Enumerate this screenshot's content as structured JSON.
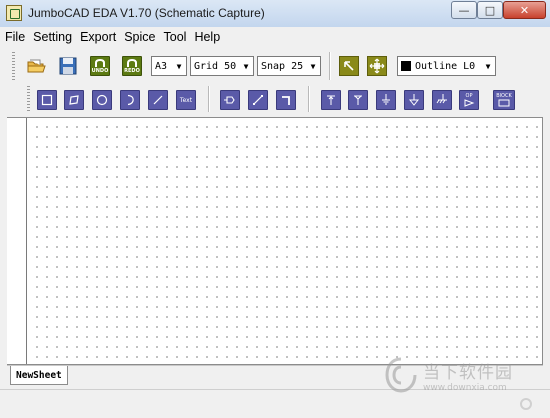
{
  "window": {
    "title": "JumboCAD EDA V1.70 (Schematic Capture)",
    "min_glyph": "—",
    "max_glyph": "□",
    "close_glyph": "✕"
  },
  "menu": [
    "File",
    "Setting",
    "Export",
    "Spice",
    "Tool",
    "Help"
  ],
  "toolbar": {
    "undo_label": "UNDO",
    "redo_label": "REDO",
    "page_size": "A3",
    "grid": "Grid 50",
    "snap": "Snap 25",
    "layer": "Outline L0",
    "text_tool_label": "Text",
    "block_label": "BlOCK",
    "opamp_label": "OP"
  },
  "icons": {
    "open": "folder-icon",
    "save": "floppy-icon",
    "undo": "undo-icon",
    "redo": "redo-icon",
    "select": "arrow-select-icon",
    "pan": "hand-icon"
  },
  "sheets": [
    "NewSheet"
  ],
  "watermark": {
    "cn": "当下软件园",
    "url": "www.downxia.com"
  },
  "colors": {
    "draw_tool_blue": "#5a5aa8",
    "undo_green": "#5c7a12",
    "select_olive": "#8a8a1a"
  }
}
